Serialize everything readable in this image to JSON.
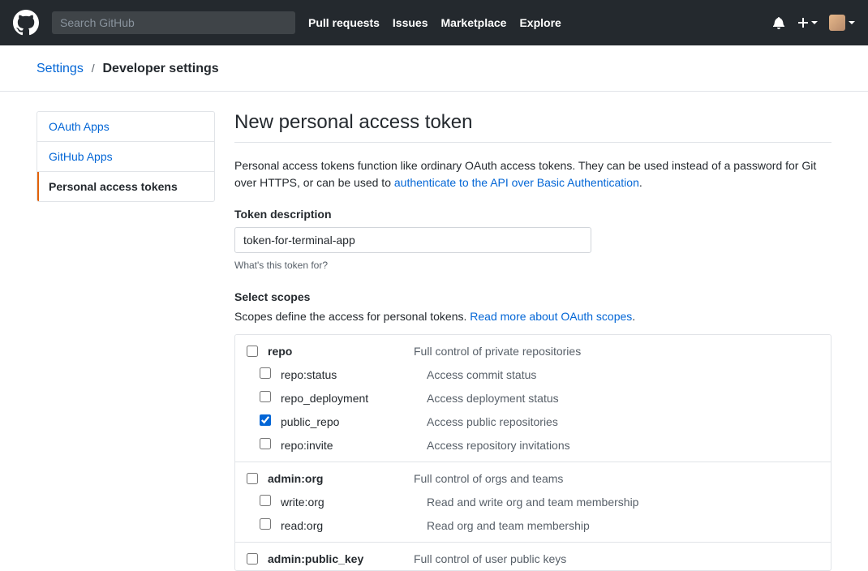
{
  "header": {
    "search_placeholder": "Search GitHub",
    "nav": [
      "Pull requests",
      "Issues",
      "Marketplace",
      "Explore"
    ]
  },
  "breadcrumb": {
    "parent": "Settings",
    "sep": "/",
    "current": "Developer settings"
  },
  "sidebar": {
    "items": [
      {
        "label": "OAuth Apps",
        "active": false
      },
      {
        "label": "GitHub Apps",
        "active": false
      },
      {
        "label": "Personal access tokens",
        "active": true
      }
    ]
  },
  "main": {
    "title": "New personal access token",
    "intro_pre": "Personal access tokens function like ordinary OAuth access tokens. They can be used instead of a password for Git over HTTPS, or can be used to ",
    "intro_link": "authenticate to the API over Basic Authentication",
    "intro_post": ".",
    "desc_label": "Token description",
    "desc_value": "token-for-terminal-app",
    "desc_hint": "What's this token for?",
    "scopes_label": "Select scopes",
    "scopes_intro_pre": "Scopes define the access for personal tokens. ",
    "scopes_intro_link": "Read more about OAuth scopes",
    "scopes_intro_post": ".",
    "scope_groups": [
      {
        "name": "repo",
        "desc": "Full control of private repositories",
        "checked": false,
        "children": [
          {
            "name": "repo:status",
            "desc": "Access commit status",
            "checked": false
          },
          {
            "name": "repo_deployment",
            "desc": "Access deployment status",
            "checked": false
          },
          {
            "name": "public_repo",
            "desc": "Access public repositories",
            "checked": true
          },
          {
            "name": "repo:invite",
            "desc": "Access repository invitations",
            "checked": false
          }
        ]
      },
      {
        "name": "admin:org",
        "desc": "Full control of orgs and teams",
        "checked": false,
        "children": [
          {
            "name": "write:org",
            "desc": "Read and write org and team membership",
            "checked": false
          },
          {
            "name": "read:org",
            "desc": "Read org and team membership",
            "checked": false
          }
        ]
      },
      {
        "name": "admin:public_key",
        "desc": "Full control of user public keys",
        "checked": false,
        "children": []
      }
    ]
  }
}
